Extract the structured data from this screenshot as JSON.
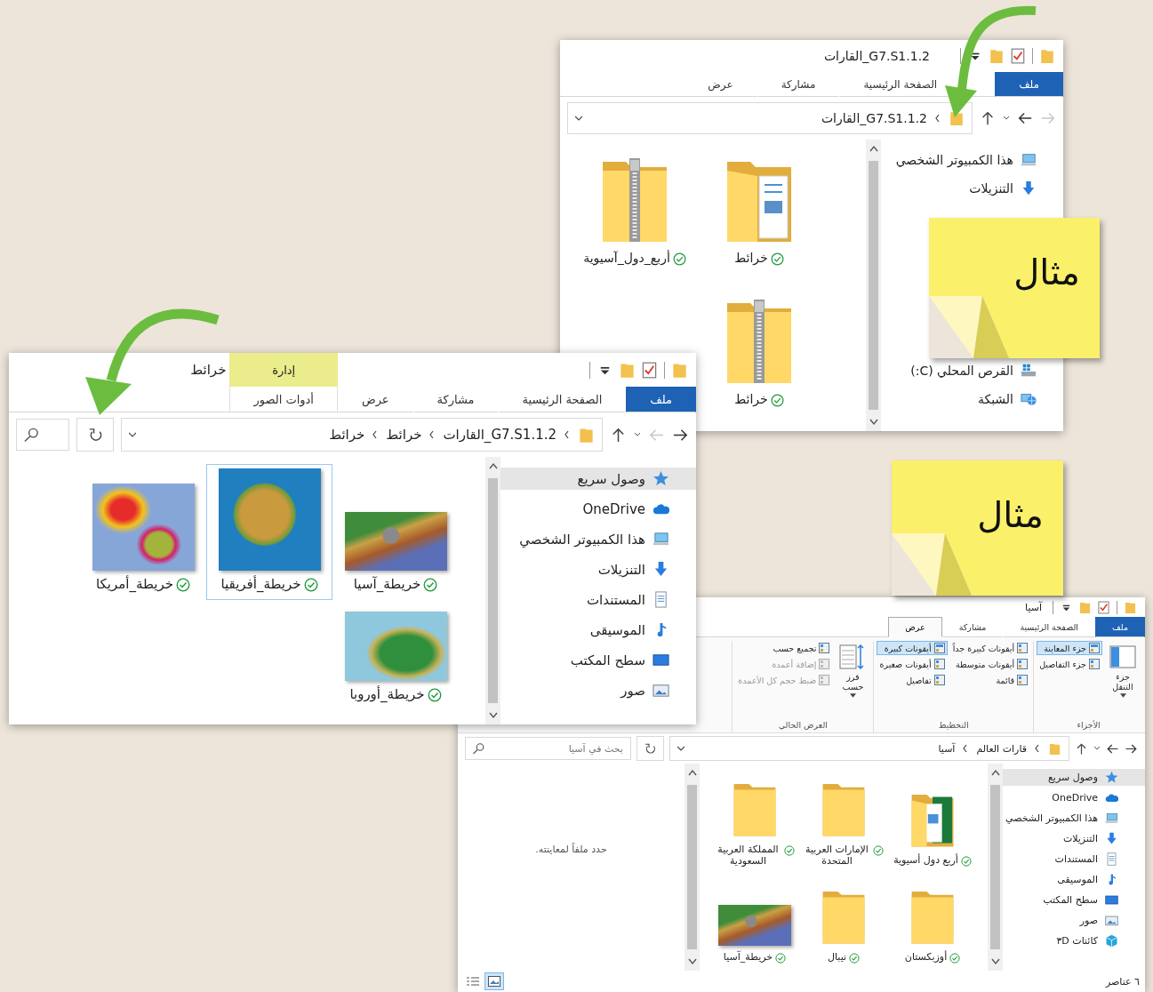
{
  "windows": [
    {
      "title": "G7.S1.1.2_القارات",
      "tabs": [
        {
          "label": "ملف",
          "kind": "file",
          "selected": false
        },
        {
          "label": "الصفحة الرئيسية",
          "kind": "tab",
          "selected": false
        },
        {
          "label": "مشاركة",
          "kind": "tab",
          "selected": false
        },
        {
          "label": "عرض",
          "kind": "tab",
          "selected": false
        }
      ],
      "nav_buttons": {
        "back": false,
        "forward": true
      },
      "breadcrumbs": [
        "G7.S1.1.2_القارات"
      ],
      "nav": [
        {
          "label": "هذا الكمبيوتر الشخصي",
          "kind": "pc",
          "selected": false
        },
        {
          "label": "التنزيلات",
          "kind": "downloads",
          "selected": false
        },
        {
          "label": "القرص المحلي (C:)",
          "kind": "drive",
          "selected": false
        },
        {
          "label": "الشبكة",
          "kind": "network",
          "selected": false
        }
      ],
      "files": [
        {
          "name": "خرائط",
          "kind": "folder-docs",
          "synced": true,
          "selected": false
        },
        {
          "name": "أربع_دول_آسيوية",
          "kind": "zip",
          "synced": true,
          "selected": false
        },
        {
          "name": "خرائط",
          "kind": "zip",
          "synced": true,
          "selected": false
        }
      ]
    },
    {
      "title": "خرائط",
      "context_group": "إدارة",
      "tabs": [
        {
          "label": "ملف",
          "kind": "file",
          "selected": false
        },
        {
          "label": "الصفحة الرئيسية",
          "kind": "tab",
          "selected": false
        },
        {
          "label": "مشاركة",
          "kind": "tab",
          "selected": false
        },
        {
          "label": "عرض",
          "kind": "tab",
          "selected": false
        },
        {
          "label": "أدوات الصور",
          "kind": "context",
          "selected": false
        }
      ],
      "nav_buttons": {
        "back": true,
        "forward": false
      },
      "breadcrumbs": [
        "G7.S1.1.2_القارات",
        "خرائط",
        "خرائط"
      ],
      "nav": [
        {
          "label": "وصول سريع",
          "kind": "quick",
          "selected": true
        },
        {
          "label": "OneDrive",
          "kind": "onedrive",
          "selected": false
        },
        {
          "label": "هذا الكمبيوتر الشخصي",
          "kind": "pc",
          "selected": false
        },
        {
          "label": "التنزيلات",
          "kind": "downloads",
          "selected": false
        },
        {
          "label": "المستندات",
          "kind": "documents",
          "selected": false
        },
        {
          "label": "الموسيقى",
          "kind": "music",
          "selected": false
        },
        {
          "label": "سطح المكتب",
          "kind": "desktop",
          "selected": false
        },
        {
          "label": "صور",
          "kind": "pictures",
          "selected": false
        }
      ],
      "files": [
        {
          "name": "خريطة_آسيا",
          "kind": "map",
          "synced": true,
          "selected": false
        },
        {
          "name": "خريطة_أفريقيا",
          "kind": "map",
          "synced": true,
          "selected": true
        },
        {
          "name": "خريطة_أمريكا",
          "kind": "map",
          "synced": true,
          "selected": false
        },
        {
          "name": "خريطة_أوروبا",
          "kind": "map",
          "synced": true,
          "selected": false
        }
      ]
    },
    {
      "title": "آسيا",
      "tabs": [
        {
          "label": "ملف",
          "kind": "file",
          "selected": false
        },
        {
          "label": "الصفحة الرئيسية",
          "kind": "tab",
          "selected": false
        },
        {
          "label": "مشاركة",
          "kind": "tab",
          "selected": false
        },
        {
          "label": "عرض",
          "kind": "tab",
          "selected": true
        }
      ],
      "ribbon_groups": [
        {
          "label": "الأجزاء",
          "items": [
            {
              "label": "جزء التنقل",
              "kind": "big",
              "selected": false,
              "disabled": false
            },
            {
              "label": "جزء المعاينة",
              "kind": "small",
              "selected": true,
              "disabled": false
            },
            {
              "label": "جزء التفاصيل",
              "kind": "small",
              "selected": false,
              "disabled": false
            }
          ]
        },
        {
          "label": "التخطيط",
          "items": [
            {
              "label": "أيقونات كبيرة جداً",
              "kind": "small",
              "selected": false,
              "disabled": false
            },
            {
              "label": "أيقونات متوسطة",
              "kind": "small",
              "selected": false,
              "disabled": false
            },
            {
              "label": "قائمة",
              "kind": "small",
              "selected": false,
              "disabled": false
            },
            {
              "label": "أيقونات كبيرة",
              "kind": "small",
              "selected": true,
              "disabled": false
            },
            {
              "label": "أيقونات صغيرة",
              "kind": "small",
              "selected": false,
              "disabled": false
            },
            {
              "label": "تفاصيل",
              "kind": "small",
              "selected": false,
              "disabled": false
            }
          ]
        },
        {
          "label": "العرض الحالي",
          "items": [
            {
              "label": "فرز حسب",
              "kind": "big",
              "selected": false,
              "disabled": false
            },
            {
              "label": "تجميع حسب",
              "kind": "small",
              "selected": false,
              "disabled": false
            },
            {
              "label": "إضافة أعمدة",
              "kind": "small",
              "selected": false,
              "disabled": true
            },
            {
              "label": "ضبط حجم كل الأعمدة",
              "kind": "small",
              "selected": false,
              "disabled": true
            }
          ]
        }
      ],
      "nav_buttons": {
        "back": true,
        "forward": true
      },
      "breadcrumbs": [
        "قارات العالم",
        "آسيا"
      ],
      "search_placeholder": "بحث في آسيا",
      "nav": [
        {
          "label": "وصول سريع",
          "kind": "quick",
          "selected": true
        },
        {
          "label": "OneDrive",
          "kind": "onedrive",
          "selected": false
        },
        {
          "label": "هذا الكمبيوتر الشخصي",
          "kind": "pc",
          "selected": false
        },
        {
          "label": "التنزيلات",
          "kind": "downloads",
          "selected": false
        },
        {
          "label": "المستندات",
          "kind": "documents",
          "selected": false
        },
        {
          "label": "الموسيقى",
          "kind": "music",
          "selected": false
        },
        {
          "label": "سطح المكتب",
          "kind": "desktop",
          "selected": false
        },
        {
          "label": "صور",
          "kind": "pictures",
          "selected": false
        },
        {
          "label": "كائنات ٣D",
          "kind": "objects3d",
          "selected": false
        }
      ],
      "files": [
        {
          "name": "أربع دول أسيوية",
          "kind": "folder-flag",
          "synced": true,
          "selected": false
        },
        {
          "name": "الإمارات العربية المتحدة",
          "kind": "folder",
          "synced": true,
          "selected": false
        },
        {
          "name": "المملكة العربية السعودية",
          "kind": "folder",
          "synced": true,
          "selected": false
        },
        {
          "name": "أوزبكستان",
          "kind": "folder",
          "synced": true,
          "selected": false
        },
        {
          "name": "نيبال",
          "kind": "folder",
          "synced": true,
          "selected": false
        },
        {
          "name": "خريطة_آسيا",
          "kind": "map",
          "synced": true,
          "selected": false
        }
      ],
      "preview_hint": "حدد ملفاً لمعاينته.",
      "status": "٦ عناصر",
      "view_buttons": [
        {
          "kind": "large-icons",
          "selected": true
        },
        {
          "kind": "details",
          "selected": false
        }
      ]
    }
  ],
  "sticky_notes": [
    {
      "text": "مثال"
    },
    {
      "text": "مثال"
    }
  ]
}
